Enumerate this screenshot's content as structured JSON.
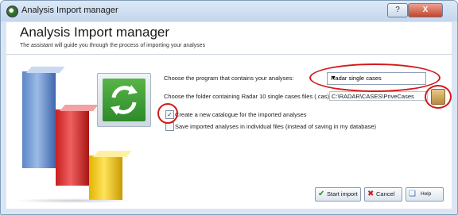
{
  "window": {
    "title": "Analysis Import manager",
    "help_label": "?",
    "close_label": "X"
  },
  "header": {
    "title": "Analysis Import manager",
    "subtitle": "The assistant will guide you through the process of importing your analyses"
  },
  "form": {
    "program_label": "Choose the program that contains your analyses:",
    "program_value": "Radar single cases",
    "folder_label": "Choose the folder containing Radar 10 single cases files (.cas):",
    "folder_value": "C:\\RADAR\\CASES\\PriveCases",
    "create_catalogue_label": "Create a new catalogue for the imported analyses",
    "create_catalogue_checked": true,
    "save_individual_label": "Save imported analyses in individual files (instead of saving in my database)",
    "save_individual_checked": false
  },
  "buttons": {
    "start_import": "Start import",
    "cancel": "Cancel",
    "help": "Help"
  },
  "colors": {
    "annotation_red": "#d21a1a",
    "sync_green": "#3a9a33"
  }
}
